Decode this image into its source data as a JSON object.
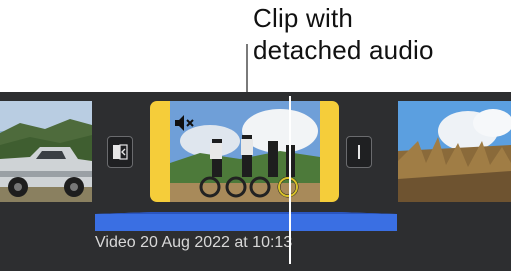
{
  "callout": {
    "line1": "Clip with",
    "line2": "detached audio"
  },
  "timeline": {
    "clip_title": "Video 20 Aug 2022 at 10:13",
    "audio_color": "#3a6fe3",
    "selected_clip_color": "#f5cd3a"
  },
  "icons": {
    "mute": "speaker-muted-icon",
    "transition_left": "transition-icon",
    "transition_right": "transition-icon"
  }
}
